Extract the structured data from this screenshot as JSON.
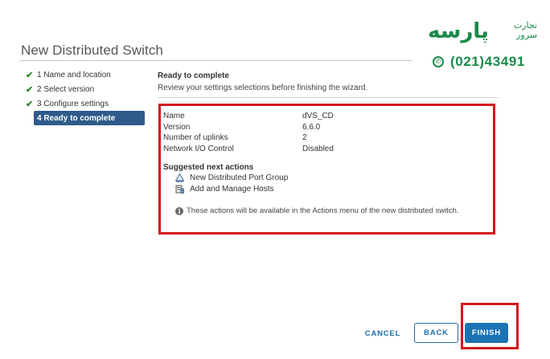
{
  "wizard": {
    "title": "New Distributed Switch",
    "steps": [
      {
        "label": "1 Name and location",
        "done": true
      },
      {
        "label": "2 Select version",
        "done": true
      },
      {
        "label": "3 Configure settings",
        "done": true
      },
      {
        "label": "4 Ready to complete",
        "active": true
      }
    ]
  },
  "content": {
    "heading": "Ready to complete",
    "subheading": "Review your settings selections before finishing the wizard.",
    "summary": [
      {
        "key": "Name",
        "value": "dVS_CD"
      },
      {
        "key": "Version",
        "value": "6.6.0"
      },
      {
        "key": "Number of uplinks",
        "value": "2"
      },
      {
        "key": "Network I/O Control",
        "value": "Disabled"
      }
    ],
    "next_actions_title": "Suggested next actions",
    "next_actions": [
      {
        "label": "New Distributed Port Group",
        "icon": "port-group-icon"
      },
      {
        "label": "Add and Manage Hosts",
        "icon": "hosts-icon"
      }
    ],
    "note": "These actions will be available in the Actions menu of the new distributed switch."
  },
  "buttons": {
    "cancel": "CANCEL",
    "back": "BACK",
    "finish": "FINISH"
  },
  "logo": {
    "brand": "پارسه",
    "brand_sub_1": "تجارت",
    "brand_sub_2": "سرور",
    "phone": "(021)43491"
  },
  "colors": {
    "accent": "#1a73b4",
    "active_step": "#2e5b8a",
    "highlight_red": "#d3161d",
    "check_green": "#2e8b2e",
    "logo_green": "#1a8a4a"
  }
}
